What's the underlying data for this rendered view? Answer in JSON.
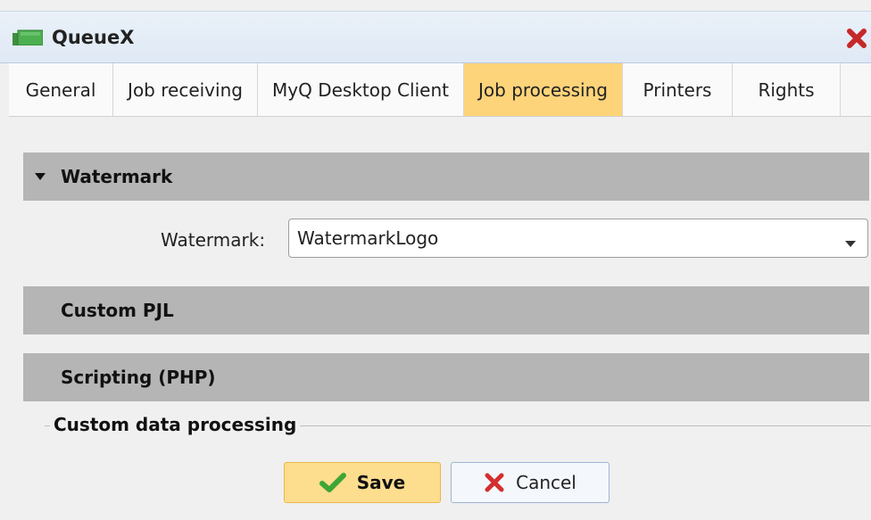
{
  "window": {
    "title": "QueueX",
    "app_icon": "queue-icon",
    "close_icon": "close-icon"
  },
  "tabs": [
    {
      "label": "General",
      "active": false
    },
    {
      "label": "Job receiving",
      "active": false
    },
    {
      "label": "MyQ Desktop Client",
      "active": false
    },
    {
      "label": "Job processing",
      "active": true
    },
    {
      "label": "Printers",
      "active": false
    },
    {
      "label": "Rights",
      "active": false
    }
  ],
  "sections": {
    "watermark": {
      "header": "Watermark",
      "expanded": true,
      "field_label": "Watermark:",
      "field_value": "WatermarkLogo"
    },
    "custom_pjl": {
      "header": "Custom PJL",
      "expanded": false
    },
    "scripting": {
      "header": "Scripting (PHP)",
      "expanded": false
    },
    "custom_data": {
      "label": "Custom data processing"
    }
  },
  "buttons": {
    "save": "Save",
    "cancel": "Cancel"
  },
  "colors": {
    "active_tab": "#fdd47a",
    "section_header": "#b5b5b5",
    "save_button": "#fddd8e",
    "check_green": "#3fa535",
    "cancel_red": "#d32f2f"
  }
}
